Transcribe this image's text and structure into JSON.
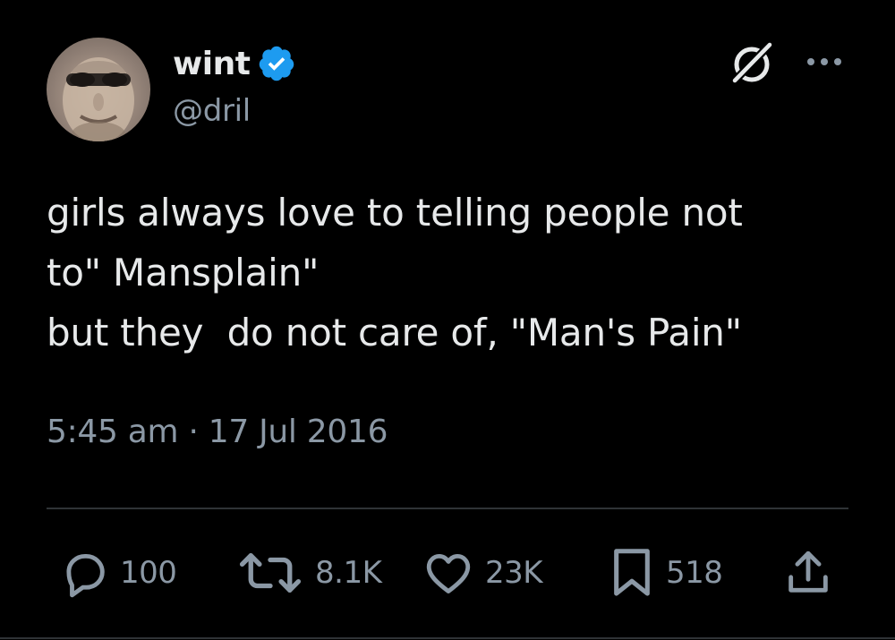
{
  "author": {
    "display_name": "wint",
    "handle": "@dril",
    "verified": true,
    "verified_color": "#1d9bf0",
    "avatar_icon": "avatar"
  },
  "header_actions": {
    "grok_icon": "grok-icon",
    "more_icon": "more-options-icon"
  },
  "tweet": {
    "lines": [
      "girls always love to telling people not",
      "to\" Mansplain\"",
      "but they  do not care of, \"Man's Pain\""
    ],
    "timestamp": "5:45 am · 17 Jul 2016"
  },
  "actions": {
    "reply": {
      "icon": "reply-icon",
      "count": "100"
    },
    "repost": {
      "icon": "repost-icon",
      "count": "8.1K"
    },
    "like": {
      "icon": "heart-icon",
      "count": "23K"
    },
    "bookmark": {
      "icon": "bookmark-icon",
      "count": "518"
    },
    "share": {
      "icon": "share-icon"
    }
  },
  "colors": {
    "background": "#000000",
    "primary_text": "#e7e9ea",
    "secondary_text": "#8b98a5",
    "divider": "#2f3336"
  }
}
